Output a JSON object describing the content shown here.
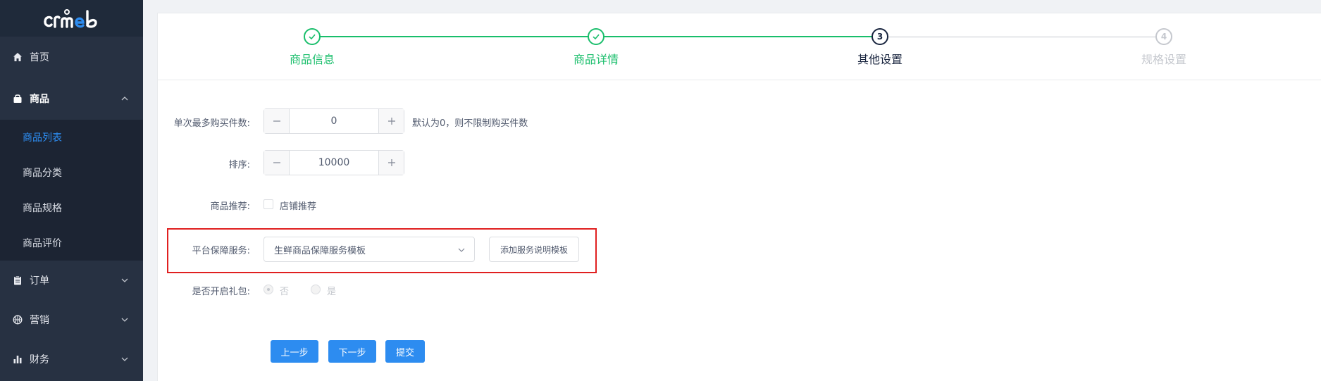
{
  "brand": {
    "logo_text": "crmeb"
  },
  "sidebar": {
    "items": [
      {
        "label": "首页",
        "icon": "home-icon"
      },
      {
        "label": "商品",
        "icon": "bag-icon",
        "expanded": true,
        "children": [
          {
            "label": "商品列表",
            "active": true
          },
          {
            "label": "商品分类"
          },
          {
            "label": "商品规格"
          },
          {
            "label": "商品评价"
          }
        ]
      },
      {
        "label": "订单",
        "icon": "clipboard-icon"
      },
      {
        "label": "营销",
        "icon": "basketball-icon"
      },
      {
        "label": "财务",
        "icon": "bar-chart-icon"
      }
    ]
  },
  "steps": [
    {
      "label": "商品信息",
      "status": "done",
      "number": "1"
    },
    {
      "label": "商品详情",
      "status": "done",
      "number": "2"
    },
    {
      "label": "其他设置",
      "status": "current",
      "number": "3"
    },
    {
      "label": "规格设置",
      "status": "wait",
      "number": "4"
    }
  ],
  "form": {
    "max_purchase": {
      "label": "单次最多购买件数:",
      "value": "0",
      "hint": "默认为0，则不限制购买件数"
    },
    "sort": {
      "label": "排序:",
      "value": "10000"
    },
    "recommend": {
      "label": "商品推荐:",
      "option": "店铺推荐",
      "checked": false
    },
    "guarantee": {
      "label": "平台保障服务:",
      "selected": "生鲜商品保障服务模板",
      "add_button": "添加服务说明模板"
    },
    "gift": {
      "label": "是否开启礼包:",
      "options": [
        "否",
        "是"
      ],
      "selected": "否",
      "disabled": true
    }
  },
  "actions": {
    "prev": "上一步",
    "next": "下一步",
    "submit": "提交"
  },
  "colors": {
    "sidebar_bg": "#273142",
    "primary": "#2d8cf0",
    "success": "#19be6b",
    "highlight": "#e02020"
  }
}
